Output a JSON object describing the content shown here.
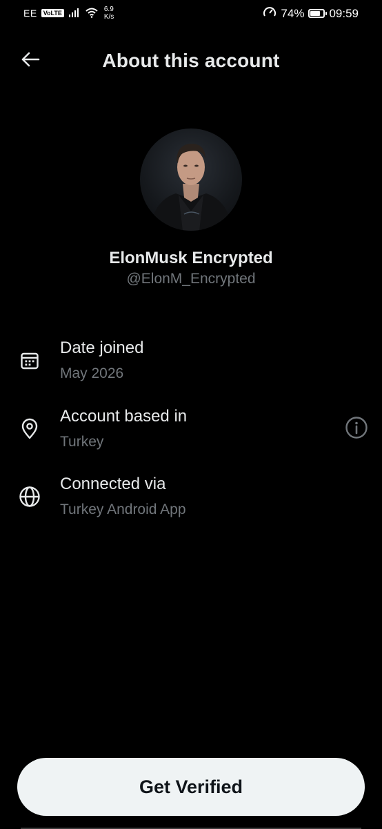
{
  "status_bar": {
    "carrier": "EE",
    "volte": "VoLTE",
    "net_speed_value": "6.9",
    "net_speed_unit": "K/s",
    "battery_percent": "74%",
    "battery_level": 0.74,
    "time": "09:59"
  },
  "header": {
    "title": "About this account",
    "back_icon": "arrow-left-icon"
  },
  "profile": {
    "display_name": "ElonMusk Encrypted",
    "handle": "@ElonM_Encrypted"
  },
  "rows": [
    {
      "icon": "calendar-icon",
      "title": "Date joined",
      "value": "May 2026"
    },
    {
      "icon": "location-pin-icon",
      "title": "Account based in",
      "value": "Turkey",
      "trailing_icon": "info-icon"
    },
    {
      "icon": "globe-icon",
      "title": "Connected via",
      "value": "Turkey Android App"
    }
  ],
  "footer": {
    "button_label": "Get Verified"
  },
  "colors": {
    "background": "#000000",
    "primary_text": "#e7e9ea",
    "secondary_text": "#71767b",
    "button_bg": "#eff3f4",
    "button_text": "#0f1419"
  }
}
